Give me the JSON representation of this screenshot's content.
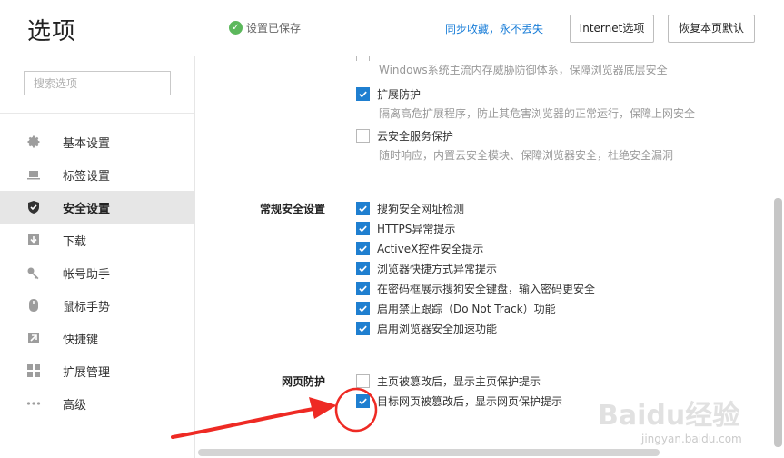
{
  "header": {
    "title": "选项",
    "saved_text": "设置已保存",
    "sync_link": "同步收藏，永不丢失",
    "internet_button": "Internet选项",
    "restore_button": "恢复本页默认"
  },
  "sidebar": {
    "search_placeholder": "搜索选项",
    "items": [
      {
        "label": "基本设置",
        "icon": "gear-icon"
      },
      {
        "label": "标签设置",
        "icon": "tab-icon"
      },
      {
        "label": "安全设置",
        "icon": "shield-icon",
        "active": true
      },
      {
        "label": "下载",
        "icon": "download-icon"
      },
      {
        "label": "帐号助手",
        "icon": "key-icon"
      },
      {
        "label": "鼠标手势",
        "icon": "mouse-icon"
      },
      {
        "label": "快捷键",
        "icon": "shortcut-arrow-icon"
      },
      {
        "label": "扩展管理",
        "icon": "extensions-grid-icon"
      },
      {
        "label": "高级",
        "icon": "more-dots-icon"
      }
    ]
  },
  "content": {
    "top_options": [
      {
        "label": "",
        "desc": "Windows系统主流内存威胁防御体系，保障浏览器底层安全",
        "checked": false
      },
      {
        "label": "扩展防护",
        "desc": "隔离高危扩展程序，防止其危害浏览器的正常运行，保障上网安全",
        "checked": true
      },
      {
        "label": "云安全服务保护",
        "desc": "随时响应，内置云安全模块、保障浏览器安全，杜绝安全漏洞",
        "checked": false
      }
    ],
    "general_security": {
      "label": "常规安全设置",
      "options": [
        {
          "label": "搜狗安全网址检测",
          "checked": true
        },
        {
          "label": "HTTPS异常提示",
          "checked": true
        },
        {
          "label": "ActiveX控件安全提示",
          "checked": true
        },
        {
          "label": "浏览器快捷方式异常提示",
          "checked": true
        },
        {
          "label": "在密码框展示搜狗安全键盘，输入密码更安全",
          "checked": true
        },
        {
          "label": "启用禁止跟踪（Do Not Track）功能",
          "checked": true
        },
        {
          "label": "启用浏览器安全加速功能",
          "checked": true
        }
      ]
    },
    "web_protection": {
      "label": "网页防护",
      "options": [
        {
          "label": "主页被篡改后，显示主页保护提示",
          "checked": false
        },
        {
          "label": "目标网页被篡改后，显示网页保护提示",
          "checked": true
        }
      ]
    }
  },
  "watermark": {
    "brand": "Baidu经验",
    "url": "jingyan.baidu.com"
  },
  "colors": {
    "accent": "#1f7fd0",
    "annotation": "#ee2a24",
    "saved_ok": "#5cb85c",
    "link": "#1a7ed8"
  }
}
